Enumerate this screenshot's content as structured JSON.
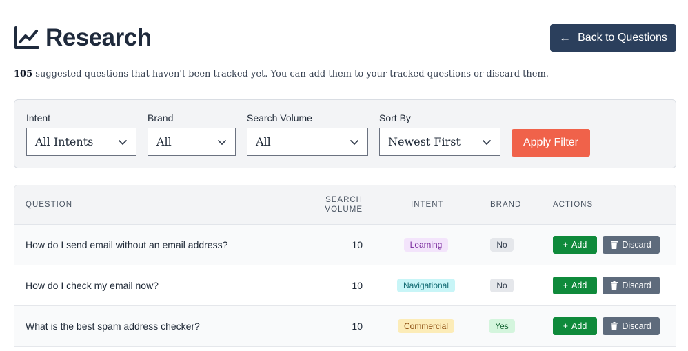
{
  "header": {
    "title": "Research",
    "back_label": "Back to Questions"
  },
  "subtitle": {
    "count": "105",
    "text": " suggested questions that haven't been tracked yet. You can add them to your tracked questions or discard them."
  },
  "filters": {
    "intent": {
      "label": "Intent",
      "value": "All Intents"
    },
    "brand": {
      "label": "Brand",
      "value": "All"
    },
    "search_volume": {
      "label": "Search Volume",
      "value": "All"
    },
    "sort_by": {
      "label": "Sort By",
      "value": "Newest First"
    },
    "apply_label": "Apply Filter"
  },
  "table": {
    "headers": {
      "question": "QUESTION",
      "search_volume_1": "SEARCH",
      "search_volume_2": "VOLUME",
      "intent": "INTENT",
      "brand": "BRAND",
      "actions": "ACTIONS"
    },
    "add_label": "Add",
    "discard_label": "Discard",
    "rows": [
      {
        "question": "How do I send email without an email address?",
        "volume": "10",
        "intent": "Learning",
        "brand": "No"
      },
      {
        "question": "How do I check my email now?",
        "volume": "10",
        "intent": "Navigational",
        "brand": "No"
      },
      {
        "question": "What is the best spam address checker?",
        "volume": "10",
        "intent": "Commercial",
        "brand": "Yes"
      }
    ]
  },
  "colors": {
    "primary_dark": "#2b3f5c",
    "apply": "#f0624a",
    "add": "#0f8a3b",
    "discard": "#5e6b7c"
  },
  "icons": [
    "chart-line-icon",
    "arrow-left-icon",
    "chevron-down-icon",
    "plus-icon",
    "trash-icon"
  ]
}
